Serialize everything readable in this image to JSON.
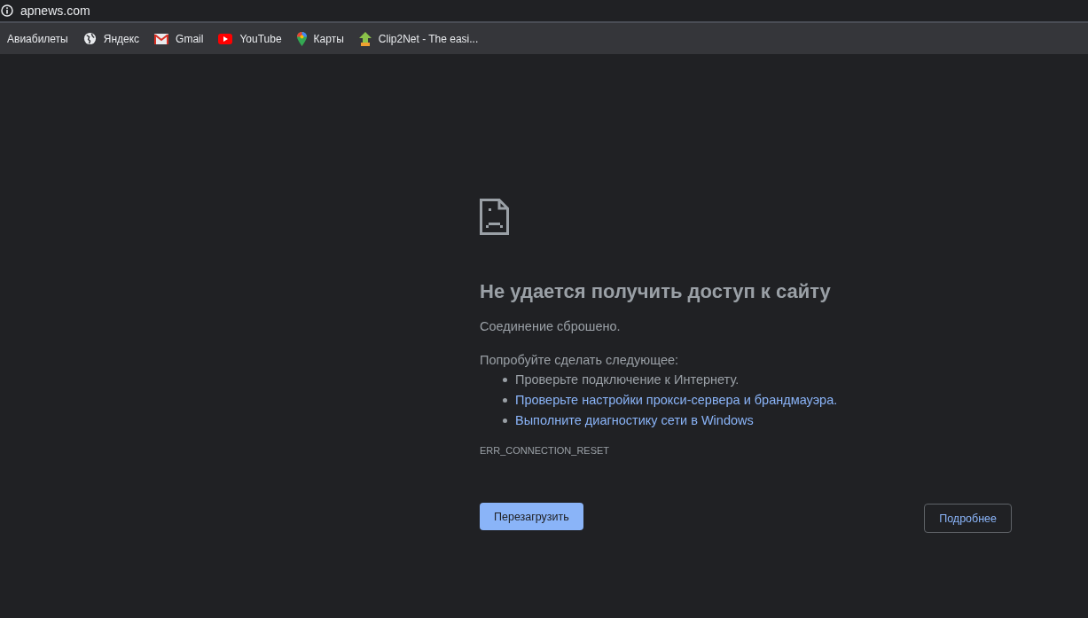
{
  "address_bar": {
    "url": "apnews.com"
  },
  "bookmarks": [
    {
      "label": "Авиабилеты",
      "kind": "plain"
    },
    {
      "label": "Яндекс",
      "kind": "globe"
    },
    {
      "label": "Gmail",
      "kind": "mail"
    },
    {
      "label": "YouTube",
      "kind": "video"
    },
    {
      "label": "Карты",
      "kind": "map"
    },
    {
      "label": "Clip2Net - The easi...",
      "kind": "upload"
    }
  ],
  "error": {
    "title": "Не удается получить доступ к сайту",
    "message": "Соединение сброшено.",
    "suggestions_heading": "Попробуйте сделать следующее:",
    "suggestions": [
      {
        "text": "Проверьте подключение к Интернету.",
        "kind": "text"
      },
      {
        "text": "Проверьте настройки прокси-сервера и брандмауэра.",
        "kind": "link"
      },
      {
        "text": "Выполните диагностику сети в Windows",
        "kind": "link"
      }
    ],
    "code": "ERR_CONNECTION_RESET"
  },
  "buttons": {
    "reload": "Перезагрузить",
    "details": "Подробнее"
  }
}
